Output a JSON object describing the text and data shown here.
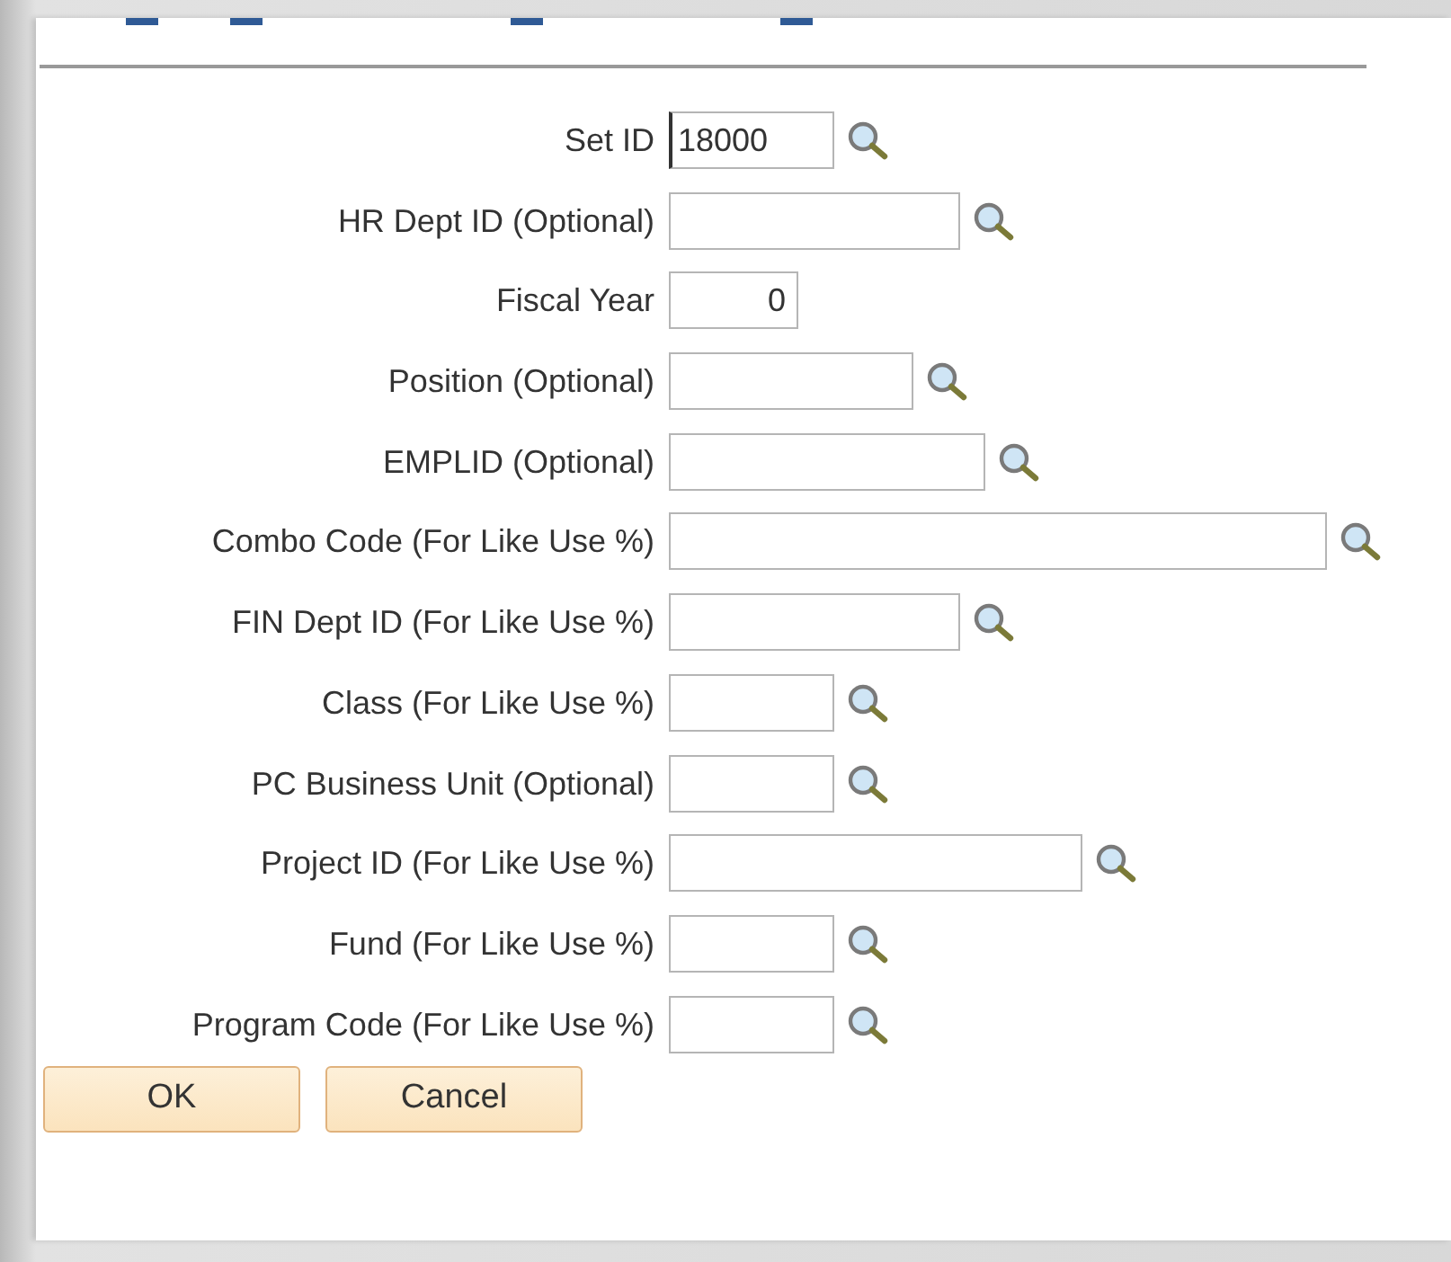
{
  "fields": [
    {
      "label": "Set ID",
      "value": "18000",
      "kind": "text",
      "lookup": true,
      "focused": true
    },
    {
      "label": "HR Dept ID (Optional)",
      "kind": "text",
      "lookup": true,
      "focused": false
    },
    {
      "label": "Fiscal Year",
      "value": "0",
      "kind": "number",
      "lookup": false,
      "focused": false
    },
    {
      "label": "Position (Optional)",
      "kind": "text",
      "lookup": true,
      "focused": false
    },
    {
      "label": "EMPLID (Optional)",
      "kind": "text",
      "lookup": true,
      "focused": false
    },
    {
      "label": "Combo Code (For Like Use %)",
      "kind": "text",
      "lookup": true,
      "focused": false
    },
    {
      "label": "FIN Dept ID (For Like Use %)",
      "kind": "text",
      "lookup": true,
      "focused": false
    },
    {
      "label": "Class (For Like Use %)",
      "kind": "text",
      "lookup": true,
      "focused": false
    },
    {
      "label": "PC Business Unit (Optional)",
      "kind": "text",
      "lookup": true,
      "focused": false
    },
    {
      "label": "Project ID (For Like Use %)",
      "kind": "text",
      "lookup": true,
      "focused": false
    },
    {
      "label": "Fund (For Like Use %)",
      "kind": "text",
      "lookup": true,
      "focused": false
    },
    {
      "label": "Program Code (For Like Use %)",
      "kind": "text",
      "lookup": true,
      "focused": false
    }
  ],
  "buttons": [
    {
      "label": "OK"
    },
    {
      "label": "Cancel"
    }
  ]
}
